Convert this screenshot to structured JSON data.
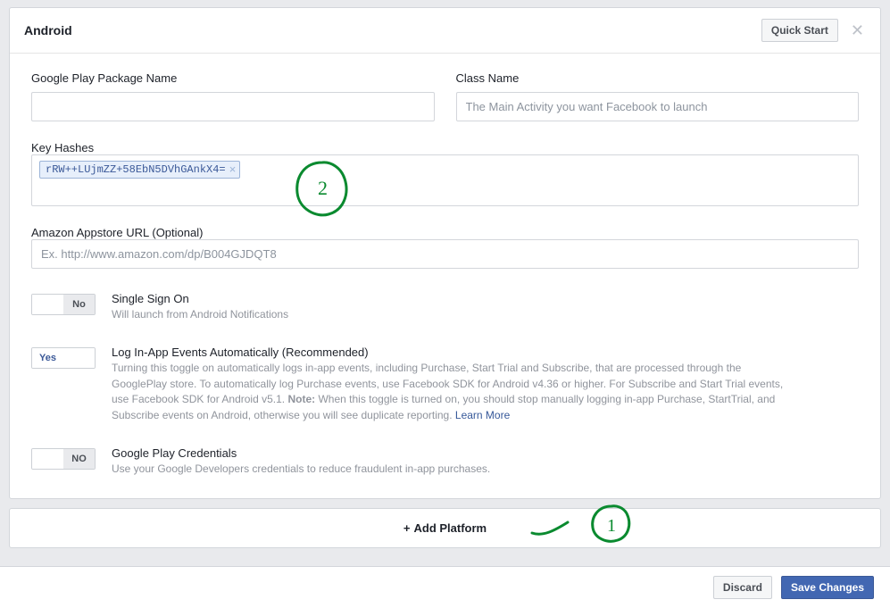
{
  "panel": {
    "title": "Android",
    "quick_start_label": "Quick Start"
  },
  "fields": {
    "package_name": {
      "label": "Google Play Package Name",
      "value": ""
    },
    "class_name": {
      "label": "Class Name",
      "placeholder": "The Main Activity you want Facebook to launch",
      "value": ""
    },
    "key_hashes": {
      "label": "Key Hashes",
      "tokens": [
        "rRW++LUjmZZ+58EbN5DVhGAnkX4="
      ]
    },
    "amazon_url": {
      "label": "Amazon Appstore URL (Optional)",
      "placeholder": "Ex. http://www.amazon.com/dp/B004GJDQT8",
      "value": ""
    }
  },
  "toggles": {
    "sso": {
      "state": "No",
      "title": "Single Sign On",
      "desc": "Will launch from Android Notifications"
    },
    "log_events": {
      "state": "Yes",
      "title": "Log In-App Events Automatically (Recommended)",
      "desc_pre": "Turning this toggle on automatically logs in-app events, including Purchase, Start Trial and Subscribe, that are processed through the GooglePlay store. To automatically log Purchase events, use Facebook SDK for Android v4.36 or higher. For Subscribe and Start Trial events, use Facebook SDK for Android v5.1. ",
      "note_label": "Note:",
      "desc_post": " When this toggle is turned on, you should stop manually logging in-app Purchase, StartTrial, and Subscribe events on Android, otherwise you will see duplicate reporting. ",
      "learn_more": "Learn More"
    },
    "gp_creds": {
      "state": "NO",
      "title": "Google Play Credentials",
      "desc": "Use your Google Developers credentials to reduce fraudulent in-app purchases."
    }
  },
  "add_platform": {
    "label": "Add Platform"
  },
  "footer": {
    "discard": "Discard",
    "save": "Save Changes"
  },
  "annotations": {
    "one": "1",
    "two": "2"
  }
}
